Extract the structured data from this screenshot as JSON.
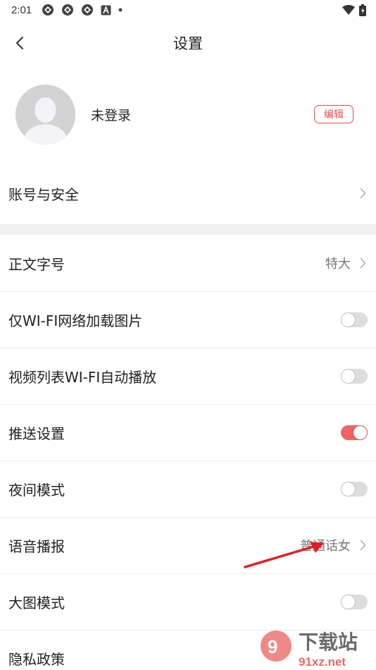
{
  "status_bar": {
    "time": "2:01"
  },
  "header": {
    "title": "设置"
  },
  "profile": {
    "name": "未登录",
    "edit_label": "编辑"
  },
  "account_row": {
    "label": "账号与安全"
  },
  "settings": {
    "font_size": {
      "label": "正文字号",
      "value": "特大"
    },
    "wifi_images": {
      "label": "仅WI-FI网络加载图片",
      "enabled": false
    },
    "video_autoplay": {
      "label": "视频列表WI-FI自动播放",
      "enabled": false
    },
    "push": {
      "label": "推送设置",
      "enabled": true
    },
    "night_mode": {
      "label": "夜间模式",
      "enabled": false
    },
    "voice": {
      "label": "语音播报",
      "value": "普通话女"
    },
    "big_image": {
      "label": "大图模式",
      "enabled": false
    },
    "privacy": {
      "label": "隐私政策"
    }
  },
  "colors": {
    "accent": "#e8504f",
    "toggle_on": "#ef6363",
    "toggle_off": "#dddddd",
    "annotation": "#e02020"
  },
  "icons": [
    "back-icon",
    "chevron-right-icon",
    "wifi-icon",
    "battery-icon",
    "avatar-placeholder-icon"
  ],
  "watermark": {
    "brand": "下载站",
    "url": "91xz.net"
  }
}
